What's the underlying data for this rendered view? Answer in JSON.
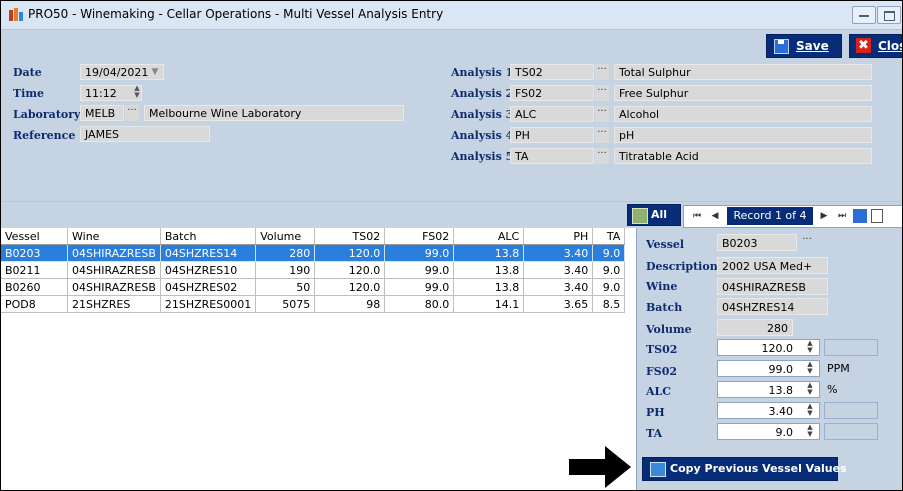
{
  "window": {
    "title": "PRO50 - Winemaking - Cellar Operations - Multi Vessel Analysis Entry"
  },
  "toolbar": {
    "save_label": "Save",
    "close_label": "Clos"
  },
  "form": {
    "date_label": "Date",
    "date_value": "19/04/2021",
    "time_label": "Time",
    "time_value": "11:12",
    "laboratory_label": "Laboratory",
    "laboratory_code": "MELB",
    "laboratory_name": "Melbourne Wine Laboratory",
    "reference_label": "Reference",
    "reference_value": "JAMES"
  },
  "analyses": [
    {
      "label": "Analysis 1",
      "code": "TS02",
      "name": "Total Sulphur"
    },
    {
      "label": "Analysis 2",
      "code": "FS02",
      "name": "Free Sulphur"
    },
    {
      "label": "Analysis 3",
      "code": "ALC",
      "name": "Alcohol"
    },
    {
      "label": "Analysis 4",
      "code": "PH",
      "name": "pH"
    },
    {
      "label": "Analysis 5",
      "code": "TA",
      "name": "Titratable Acid"
    }
  ],
  "grid_toolbar": {
    "all_label": "All",
    "record_label": "Record 1 of 4"
  },
  "grid": {
    "columns": [
      "Vessel",
      "Wine",
      "Batch",
      "Volume",
      "TS02",
      "FS02",
      "ALC",
      "PH",
      "TA"
    ],
    "rows": [
      {
        "vessel": "B0203",
        "wine": "04SHIRAZRESB",
        "batch": "04SHZRES14",
        "volume": "280",
        "ts02": "120.0",
        "fs02": "99.0",
        "alc": "13.8",
        "ph": "3.40",
        "ta": "9.0",
        "selected": true
      },
      {
        "vessel": "B0211",
        "wine": "04SHIRAZRESB",
        "batch": "04SHZRES10",
        "volume": "190",
        "ts02": "120.0",
        "fs02": "99.0",
        "alc": "13.8",
        "ph": "3.40",
        "ta": "9.0",
        "selected": false
      },
      {
        "vessel": "B0260",
        "wine": "04SHIRAZRESB",
        "batch": "04SHZRES02",
        "volume": "50",
        "ts02": "120.0",
        "fs02": "99.0",
        "alc": "13.8",
        "ph": "3.40",
        "ta": "9.0",
        "selected": false
      },
      {
        "vessel": "POD8",
        "wine": "21SHZRES",
        "batch": "21SHZRES0001",
        "volume": "5075",
        "ts02": "98",
        "fs02": "80.0",
        "alc": "14.1",
        "ph": "3.65",
        "ta": "8.5",
        "selected": false
      }
    ]
  },
  "detail": {
    "vessel_label": "Vessel",
    "vessel_value": "B0203",
    "description_label": "Description",
    "description_value": "2002 USA Med+",
    "wine_label": "Wine",
    "wine_value": "04SHIRAZRESB",
    "batch_label": "Batch",
    "batch_value": "04SHZRES14",
    "volume_label": "Volume",
    "volume_value": "280",
    "ts02_label": "TS02",
    "ts02_value": "120.0",
    "fs02_label": "FS02",
    "fs02_value": "99.0",
    "fs02_unit": "PPM",
    "alc_label": "ALC",
    "alc_value": "13.8",
    "alc_unit": "%",
    "ph_label": "PH",
    "ph_value": "3.40",
    "ta_label": "TA",
    "ta_value": "9.0"
  },
  "copy_button_label": "Copy Previous Vessel Values",
  "colors": {
    "panel_bg": "#c6d3e3",
    "button_bg": "#072d78",
    "selected_row": "#2a7fdc",
    "label_blue": "#0d2b6e"
  },
  "icons": [
    "app-icon",
    "save-icon",
    "close-icon",
    "ellipsis-icon",
    "spinner-icon",
    "dropdown-icon",
    "all-icon",
    "first-record-icon",
    "prev-record-icon",
    "next-record-icon",
    "last-record-icon",
    "arrow-icon"
  ]
}
